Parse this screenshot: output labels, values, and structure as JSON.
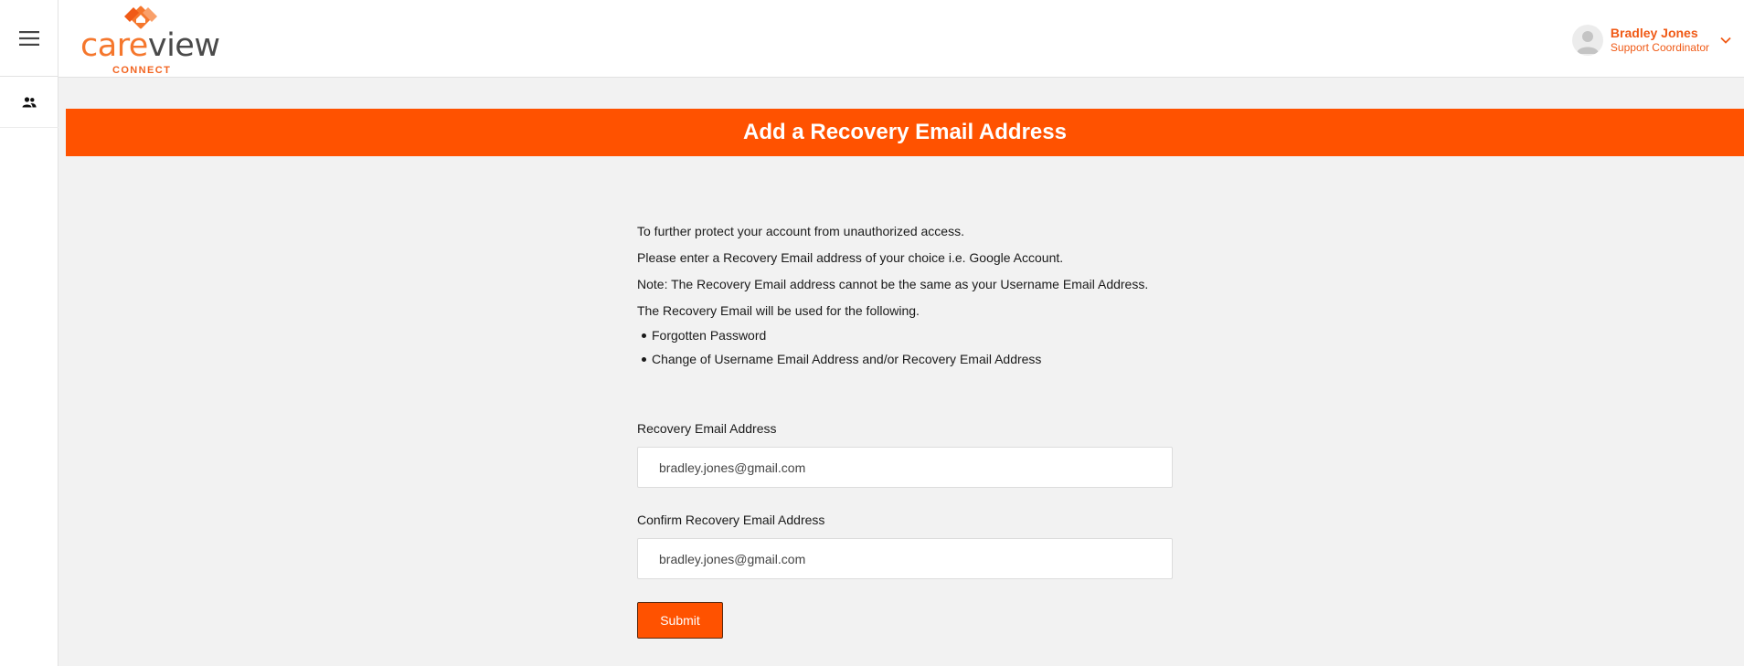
{
  "app": {
    "logo_care": "care",
    "logo_view": "view",
    "logo_sub": "CONNECT"
  },
  "user": {
    "name": "Bradley Jones",
    "role": "Support Coordinator"
  },
  "page": {
    "title": "Add a Recovery Email Address"
  },
  "intro": {
    "lines": [
      "To further protect your account from unauthorized access.",
      "Please enter a Recovery Email address of your choice i.e. Google Account.",
      "Note: The Recovery Email address cannot be the same as your Username Email Address.",
      "The Recovery Email will be used for the following."
    ],
    "bullets": [
      "Forgotten Password",
      "Change of Username Email Address and/or Recovery Email Address"
    ]
  },
  "form": {
    "recovery_label": "Recovery Email Address",
    "recovery_value": "bradley.jones@gmail.com",
    "confirm_label": "Confirm Recovery Email Address",
    "confirm_value": "bradley.jones@gmail.com",
    "submit_label": "Submit"
  },
  "colors": {
    "accent": "#ff5200",
    "logo_orange": "#f5772d",
    "user_text": "#f05a16"
  },
  "icons": {
    "menu": "hamburger-menu-icon",
    "people": "people-icon",
    "avatar": "user-avatar-icon",
    "chevron": "chevron-down-icon",
    "logo_mark": "careview-logo-mark"
  }
}
